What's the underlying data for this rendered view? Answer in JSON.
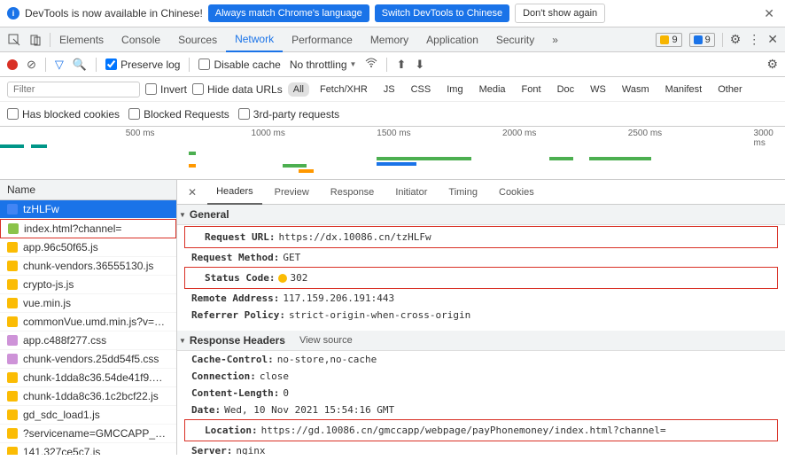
{
  "banner": {
    "text": "DevTools is now available in Chinese!",
    "btn1": "Always match Chrome's language",
    "btn2": "Switch DevTools to Chinese",
    "btn3": "Don't show again"
  },
  "tabs": [
    "Elements",
    "Console",
    "Sources",
    "Network",
    "Performance",
    "Memory",
    "Application",
    "Security"
  ],
  "selectedTab": "Network",
  "badges": {
    "warn": "9",
    "info": "9"
  },
  "toolbar": {
    "preserve": "Preserve log",
    "disable_cache": "Disable cache",
    "throttling": "No throttling"
  },
  "filter": {
    "placeholder": "Filter",
    "invert": "Invert",
    "hide_urls": "Hide data URLs",
    "types": [
      "All",
      "Fetch/XHR",
      "JS",
      "CSS",
      "Img",
      "Media",
      "Font",
      "Doc",
      "WS",
      "Wasm",
      "Manifest",
      "Other"
    ],
    "blocked_cookies": "Has blocked cookies",
    "blocked_req": "Blocked Requests",
    "third_party": "3rd-party requests"
  },
  "timeline": {
    "labels": [
      {
        "pos": 16,
        "text": "500 ms"
      },
      {
        "pos": 32,
        "text": "1000 ms"
      },
      {
        "pos": 48,
        "text": "1500 ms"
      },
      {
        "pos": 64,
        "text": "2000 ms"
      },
      {
        "pos": 80,
        "text": "2500 ms"
      },
      {
        "pos": 96,
        "text": "3000 ms"
      }
    ]
  },
  "requests": {
    "header": "Name",
    "items": [
      {
        "name": "tzHLFw",
        "type": "doc",
        "sel": true
      },
      {
        "name": "index.html?channel=",
        "type": "html",
        "hl": true
      },
      {
        "name": "app.96c50f65.js",
        "type": "js"
      },
      {
        "name": "chunk-vendors.36555130.js",
        "type": "js"
      },
      {
        "name": "crypto-js.js",
        "type": "js"
      },
      {
        "name": "vue.min.js",
        "type": "js"
      },
      {
        "name": "commonVue.umd.min.js?v=…",
        "type": "js"
      },
      {
        "name": "app.c488f277.css",
        "type": "css"
      },
      {
        "name": "chunk-vendors.25dd54f5.css",
        "type": "css"
      },
      {
        "name": "chunk-1dda8c36.54de41f9.…",
        "type": "js"
      },
      {
        "name": "chunk-1dda8c36.1c2bcf22.js",
        "type": "js"
      },
      {
        "name": "gd_sdc_load1.js",
        "type": "js"
      },
      {
        "name": "?servicename=GMCCAPP_…",
        "type": "js"
      },
      {
        "name": "141.327ce5c7.js",
        "type": "js"
      }
    ]
  },
  "detailTabs": [
    "Headers",
    "Preview",
    "Response",
    "Initiator",
    "Timing",
    "Cookies"
  ],
  "general": {
    "title": "General",
    "request_url_k": "Request URL:",
    "request_url_v": "https://dx.10086.cn/tzHLFw",
    "request_method_k": "Request Method:",
    "request_method_v": "GET",
    "status_code_k": "Status Code:",
    "status_code_v": "302",
    "remote_addr_k": "Remote Address:",
    "remote_addr_v": "117.159.206.191:443",
    "referrer_k": "Referrer Policy:",
    "referrer_v": "strict-origin-when-cross-origin"
  },
  "response_headers": {
    "title": "Response Headers",
    "view_source": "View source",
    "cache_k": "Cache-Control:",
    "cache_v": "no-store,no-cache",
    "conn_k": "Connection:",
    "conn_v": "close",
    "clen_k": "Content-Length:",
    "clen_v": "0",
    "date_k": "Date:",
    "date_v": "Wed, 10 Nov 2021 15:54:16 GMT",
    "loc_k": "Location:",
    "loc_v": "https://gd.10086.cn/gmccapp/webpage/payPhonemoney/index.html?channel=",
    "srv_k": "Server:",
    "srv_v": "nginx"
  }
}
